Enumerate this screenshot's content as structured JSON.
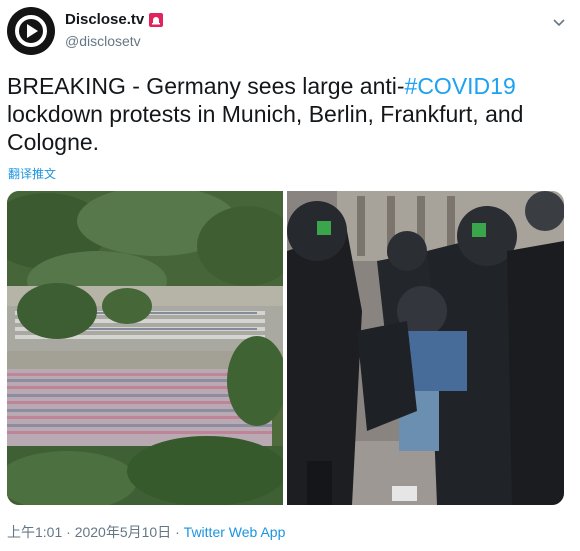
{
  "account": {
    "display_name": "Disclose.tv",
    "handle": "@disclosetv",
    "avatar_icon": "disclose-logo-icon",
    "badge_icon": "alarm-siren-icon",
    "badge_color": "#e0245e"
  },
  "tweet": {
    "text_before": "BREAKING - Germany sees large anti-",
    "hashtag": "#COVID19",
    "text_after": " lockdown protests in Munich, Berlin, Frankfurt, and Cologne.",
    "translate_label": "翻译推文"
  },
  "footer": {
    "time": "上午1:01",
    "separator": " · ",
    "date": "2020年5月10日",
    "separator2": " · ",
    "source": "Twitter Web App"
  },
  "colors": {
    "link": "#1da1f2",
    "meta_text": "#657786",
    "text": "#14171a"
  }
}
